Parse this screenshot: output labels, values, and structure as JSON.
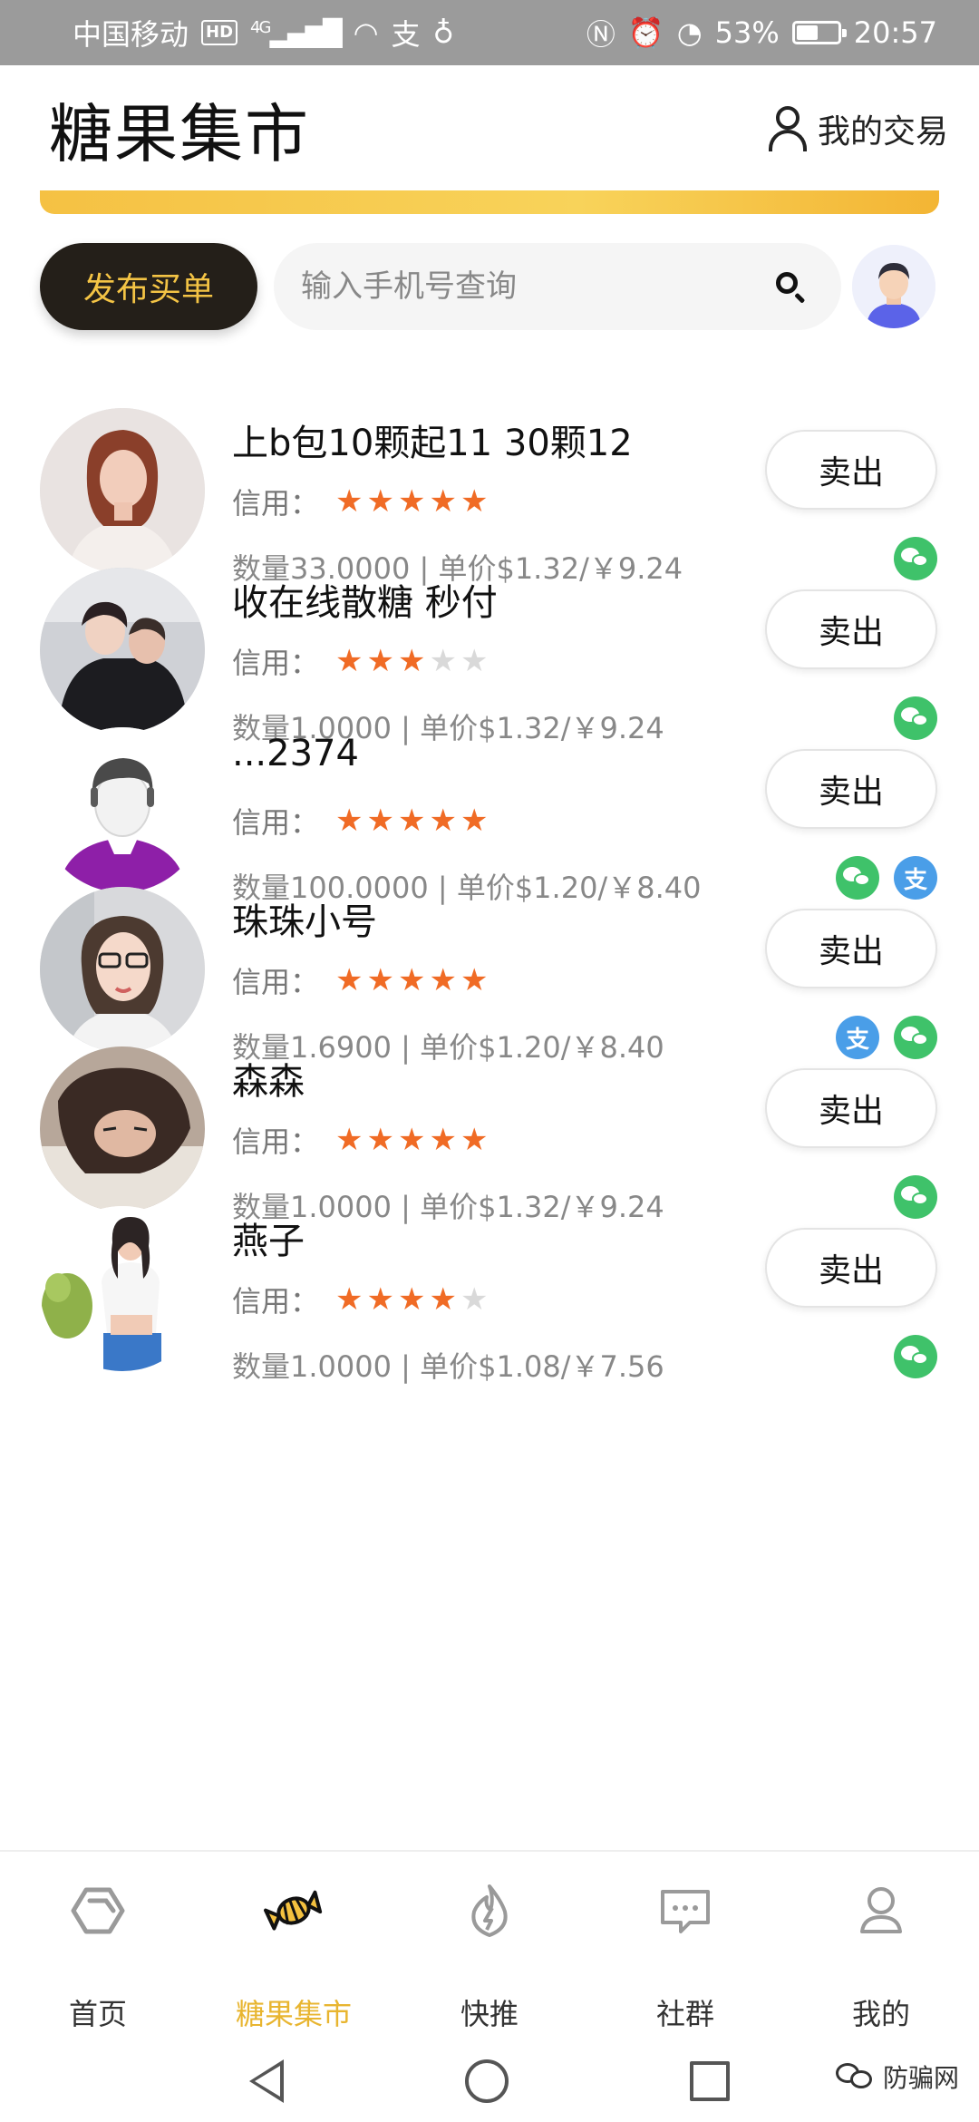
{
  "status_bar": {
    "carrier": "中国移动",
    "hd_badge": "HD",
    "network": "4G",
    "battery_percent": "53%",
    "battery_level": 0.53,
    "time": "20:57"
  },
  "header": {
    "title": "糖果集市",
    "my_trades_label": "我的交易"
  },
  "toolbar": {
    "post_buy_label": "发布买单",
    "search_placeholder": "输入手机号查询"
  },
  "listings": [
    {
      "title": "上b包10颗起11 30颗12",
      "credit_label": "信用：",
      "stars": 5,
      "info": "数量33.0000 | 单价$1.32/￥9.24",
      "sell_label": "卖出",
      "payments": [
        "wechat"
      ]
    },
    {
      "title": "收在线散糖 秒付",
      "credit_label": "信用：",
      "stars": 3,
      "info": "数量1.0000 | 单价$1.32/￥9.24",
      "sell_label": "卖出",
      "payments": [
        "wechat"
      ]
    },
    {
      "title": "...2374",
      "credit_label": "信用：",
      "stars": 5,
      "info": "数量100.0000 | 单价$1.20/￥8.40",
      "sell_label": "卖出",
      "payments": [
        "wechat",
        "alipay"
      ]
    },
    {
      "title": "珠珠小号",
      "credit_label": "信用：",
      "stars": 5,
      "info": "数量1.6900 | 单价$1.20/￥8.40",
      "sell_label": "卖出",
      "payments": [
        "alipay",
        "wechat"
      ]
    },
    {
      "title": "森森",
      "credit_label": "信用：",
      "stars": 5,
      "info": "数量1.0000 | 单价$1.32/￥9.24",
      "sell_label": "卖出",
      "payments": [
        "wechat"
      ]
    },
    {
      "title": "燕子",
      "credit_label": "信用：",
      "stars": 4,
      "info": "数量1.0000 | 单价$1.08/￥7.56",
      "sell_label": "卖出",
      "payments": [
        "wechat"
      ]
    }
  ],
  "alipay_glyph": "支",
  "star_glyph": "★",
  "bottom_nav": {
    "items": [
      {
        "label": "首页",
        "icon": "home-hexagon-icon"
      },
      {
        "label": "糖果集市",
        "icon": "candy-icon",
        "active": true
      },
      {
        "label": "快推",
        "icon": "flame-icon"
      },
      {
        "label": "社群",
        "icon": "chat-bubble-icon"
      },
      {
        "label": "我的",
        "icon": "person-icon"
      }
    ]
  },
  "watermark": "防骗网",
  "colors": {
    "accent_yellow": "#f5c143",
    "star_orange": "#f06b25",
    "wechat_green": "#3fc26a",
    "alipay_blue": "#4a9ee8",
    "dark_button": "#241f19"
  }
}
